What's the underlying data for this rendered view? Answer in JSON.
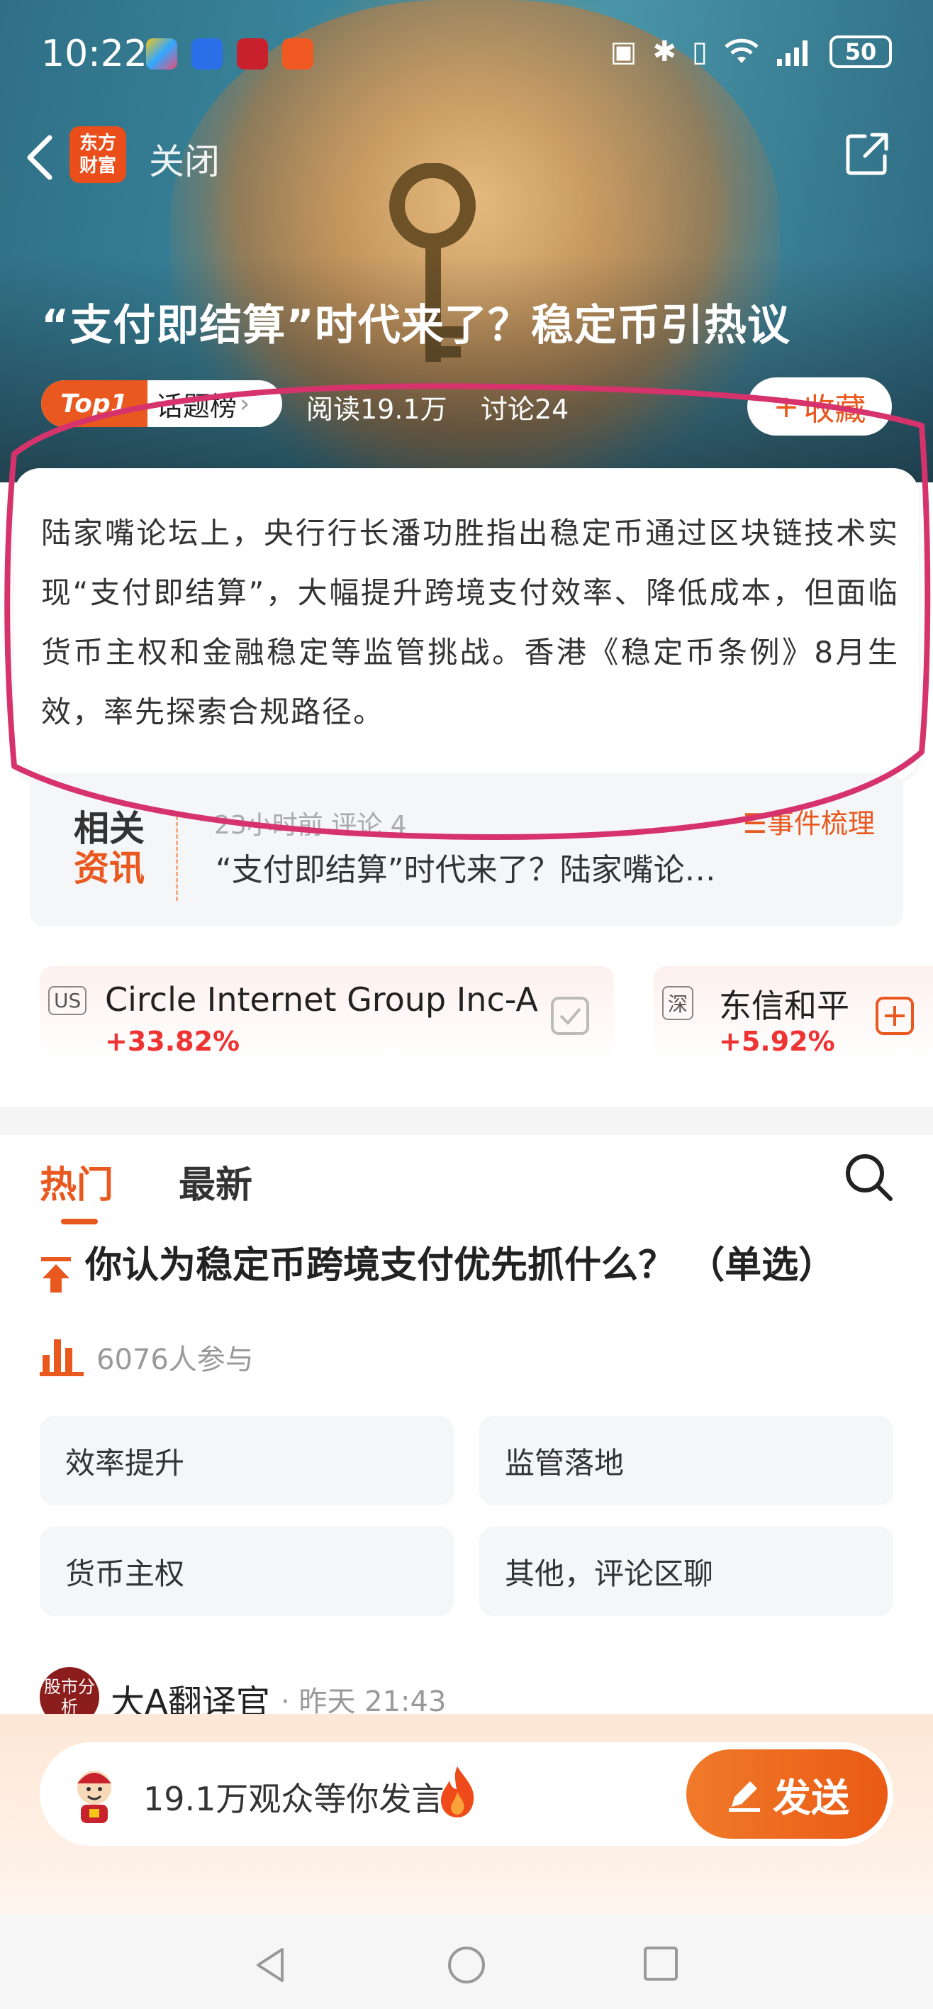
{
  "status_bar": {
    "time": "10:22",
    "battery": "50"
  },
  "nav": {
    "logo_line1": "东方",
    "logo_line2": "财富",
    "close_label": "关闭"
  },
  "topic": {
    "title": "“支付即结算”时代来了？稳定币引热议",
    "rank_badge": "Top1",
    "rank_list": "话题榜",
    "reads": "阅读19.1万",
    "discussions": "讨论24",
    "favorite_label": "收藏"
  },
  "summary": {
    "text": "陆家嘴论坛上，央行行长潘功胜指出稳定币通过区块链技术实现“支付即结算”，大幅提升跨境支付效率、降低成本，但面临货币主权和金融稳定等监管挑战。香港《稳定币条例》8月生效，率先探索合规路径。"
  },
  "related": {
    "tag_line1": "相关",
    "tag_line2": "资讯",
    "meta": "23小时前 评论 4",
    "timeline_label": "☰事件梳理",
    "headline": "“支付即结算”时代来了？陆家嘴论…"
  },
  "stocks": [
    {
      "market": "US",
      "name": "Circle Internet Group Inc-A",
      "change": "+33.82%"
    },
    {
      "market": "深",
      "name": "东信和平",
      "change": "+5.92%"
    }
  ],
  "tabs": {
    "hot": "热门",
    "latest": "最新"
  },
  "poll": {
    "question": "你认为稳定币跨境支付优先抓什么？  （单选）",
    "participants": "6076人参与",
    "options": [
      "效率提升",
      "监管落地",
      "货币主权",
      "其他，评论区聊"
    ]
  },
  "post": {
    "avatar_text": "股市分析",
    "author": "大A翻译官",
    "time": "· 昨天 21:43"
  },
  "comment_bar": {
    "placeholder": "19.1万观众等你发言",
    "send_label": "发送"
  },
  "colors": {
    "accent": "#e9581f",
    "rise": "#e33333",
    "annotation": "#d6336c"
  }
}
